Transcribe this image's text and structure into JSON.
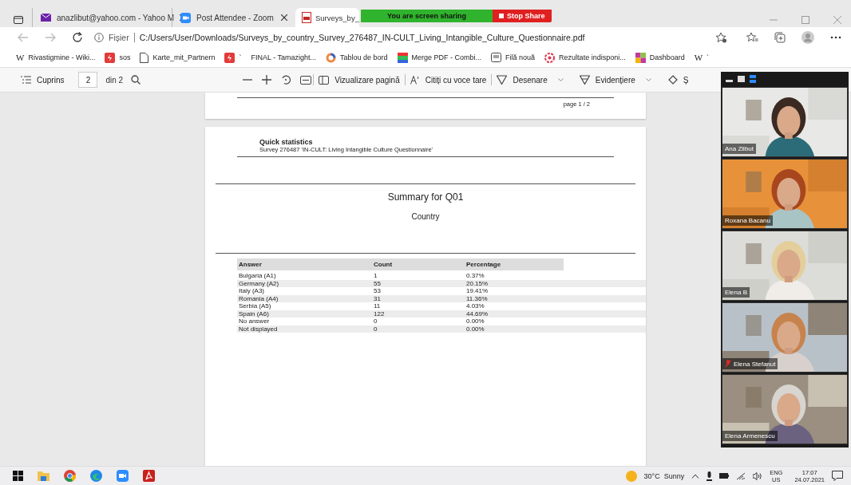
{
  "tabs": [
    {
      "title": "anazlibut@yahoo.com - Yahoo M",
      "kind": "mail",
      "selected": false
    },
    {
      "title": "Post Attendee - Zoom",
      "kind": "zoom",
      "selected": false
    },
    {
      "title": "Surveys_by_",
      "kind": "pdf",
      "selected": true
    }
  ],
  "share_banner": {
    "message": "You are screen sharing",
    "stop_label": "Stop Share"
  },
  "address_bar": {
    "scheme_label": "Fișier",
    "url": "C:/Users/User/Downloads/Surveys_by_country_Survey_276487_IN-CULT_Living_Intangible_Culture_Questionnaire.pdf"
  },
  "bookmarks": [
    {
      "label": "Rivastigmine - Wiki...",
      "kind": "wiki",
      "icon_text": "W"
    },
    {
      "label": "sos",
      "kind": "red"
    },
    {
      "label": "Karte_mit_Partnern",
      "kind": "doc"
    },
    {
      "label": "`",
      "kind": "red"
    },
    {
      "label": "FINAL - Tamazight...",
      "kind": "none"
    },
    {
      "label": "Tablou de bord",
      "kind": "ring"
    },
    {
      "label": "Merge PDF - Combi...",
      "kind": "grid"
    },
    {
      "label": "Filă nouă",
      "kind": "tab"
    },
    {
      "label": "Rezultate indisponi...",
      "kind": "flower"
    },
    {
      "label": "Dashboard",
      "kind": "squares"
    },
    {
      "label": "`",
      "kind": "wiki",
      "icon_text": "W"
    }
  ],
  "pdf_toolbar": {
    "contents_label": "Cuprins",
    "page": "2",
    "page_total": "din 2",
    "page_view_label": "Vizualizare pagină",
    "read_aloud_label": "Citiți cu voce tare",
    "draw_label": "Desenare",
    "highlight_label": "Evidențiere",
    "erase_label": "Ș"
  },
  "document": {
    "page_footer": "page 1 / 2",
    "heading": "Quick statistics",
    "survey": "Survey 276487 'IN-CULT: Living Intangible Culture Questionnaire'",
    "summary_title": "Summary for Q01",
    "question": "Country",
    "table": {
      "columns": [
        "Answer",
        "Count",
        "Percentage"
      ],
      "rows": [
        [
          "Bulgaria (A1)",
          "1",
          "0.37%"
        ],
        [
          "Germany (A2)",
          "55",
          "20.15%"
        ],
        [
          "Italy (A3)",
          "53",
          "19.41%"
        ],
        [
          "Romania (A4)",
          "31",
          "11.36%"
        ],
        [
          "Serbia (A5)",
          "11",
          "4.03%"
        ],
        [
          "Spain (A6)",
          "122",
          "44.69%"
        ],
        [
          "No answer",
          "0",
          "0.00%"
        ],
        [
          "Not displayed",
          "0",
          "0.00%"
        ]
      ]
    }
  },
  "participants": [
    {
      "name": "Ana Zlibut",
      "muted": false,
      "kind": "picture"
    },
    {
      "name": "Roxana Bacanu",
      "muted": false,
      "kind": "picture"
    },
    {
      "name": "Elena B",
      "muted": false,
      "kind": "picture"
    },
    {
      "name": "Elena Stefanut",
      "muted": true,
      "kind": "picture"
    },
    {
      "name": "Elena Armenescu",
      "muted": false,
      "kind": "picture"
    }
  ],
  "taskbar": {
    "apps": [
      {
        "kind": "windows"
      },
      {
        "kind": "folder"
      },
      {
        "kind": "chrome"
      },
      {
        "kind": "edge"
      },
      {
        "kind": "zoom"
      },
      {
        "kind": "acrobat"
      }
    ],
    "weather": "30°C  Sunny",
    "language": "ENG",
    "region": "US",
    "time": "17:07",
    "date": "24.07.2021"
  }
}
